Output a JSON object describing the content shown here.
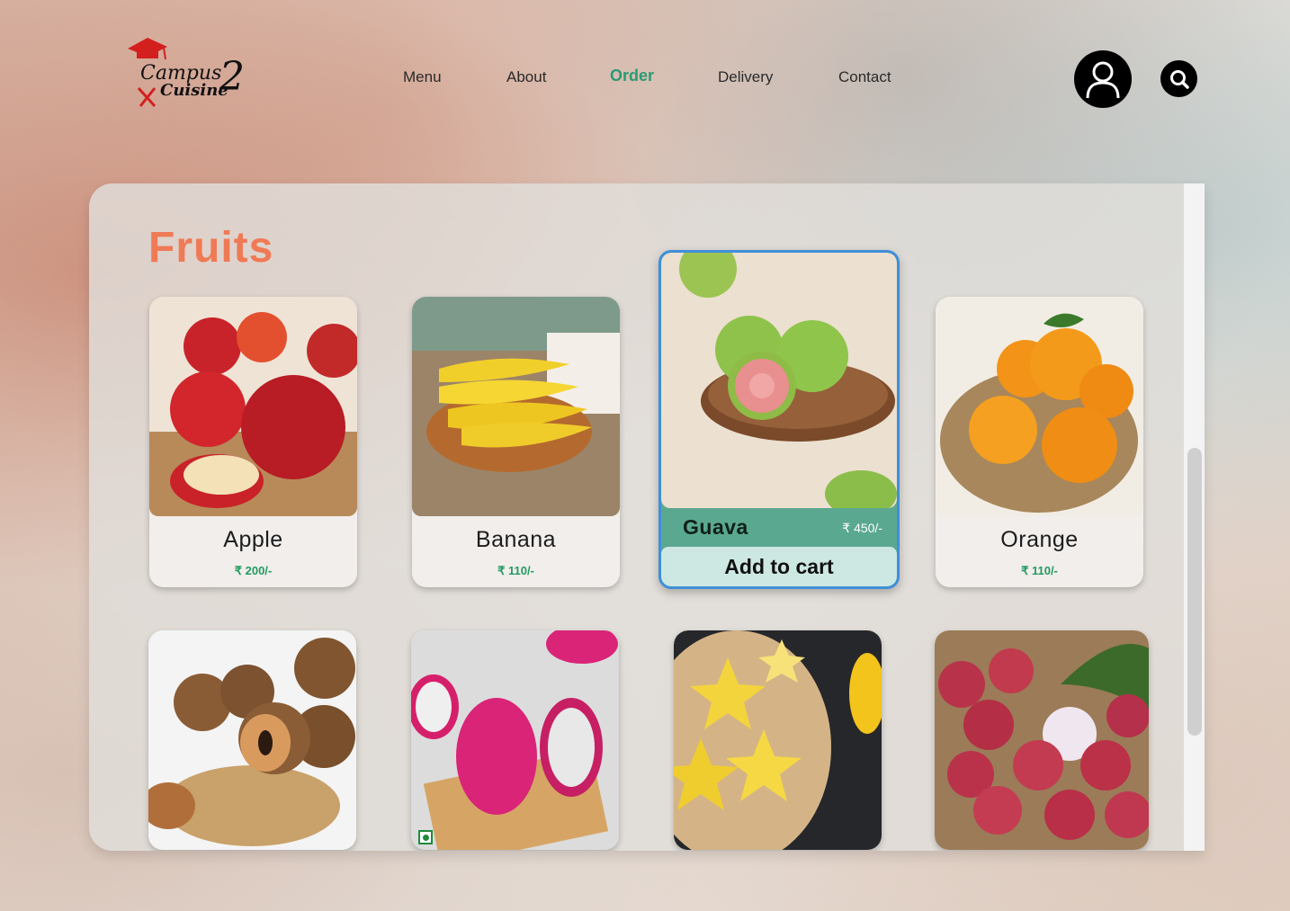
{
  "brand": {
    "logo_line1": "Campus",
    "logo_line2": "Cuisine",
    "logo_number": "2"
  },
  "nav": {
    "items": [
      {
        "label": "Menu"
      },
      {
        "label": "About"
      },
      {
        "label": "Order",
        "active": true
      },
      {
        "label": "Delivery"
      },
      {
        "label": "Contact"
      }
    ]
  },
  "header_icons": {
    "profile": "user-icon",
    "search": "search-icon"
  },
  "section": {
    "title": "Fruits"
  },
  "products": [
    {
      "name": "Apple",
      "price": "₹ 200/-",
      "image": "apple-image"
    },
    {
      "name": "Banana",
      "price": "₹ 110/-",
      "image": "banana-image"
    },
    {
      "name": "Guava",
      "price": "₹ 450/-",
      "image": "guava-image",
      "cta": "Add to cart"
    },
    {
      "name": "Orange",
      "price": "₹ 110/-",
      "image": "orange-image"
    },
    {
      "image": "sapota-image"
    },
    {
      "image": "dragon-fruit-image"
    },
    {
      "image": "star-fruit-image"
    },
    {
      "image": "lychee-image"
    }
  ],
  "colors": {
    "accent": "#2a9a73",
    "title": "#ef7a55",
    "price": "#239a5f",
    "featured_bg": "#5aa88f",
    "featured_border": "#3f8fd8"
  }
}
